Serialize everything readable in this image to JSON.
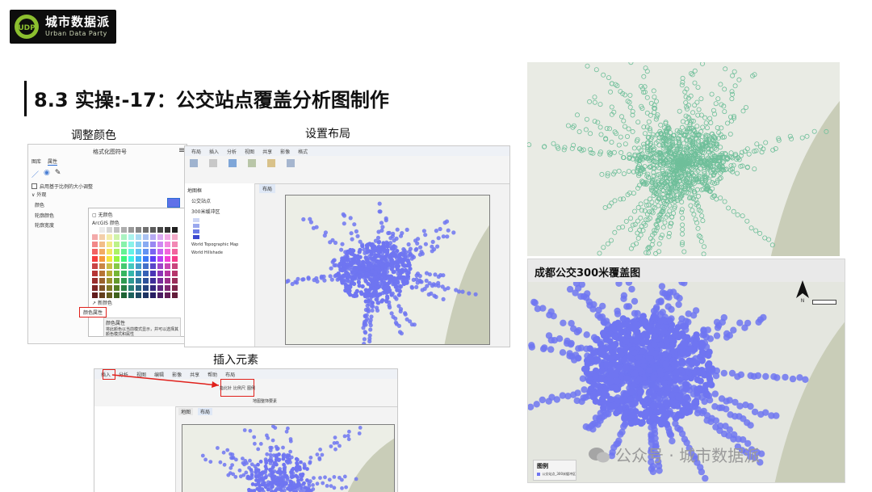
{
  "logo": {
    "name_cn": "城市数据派",
    "name_en": "Urban Data Party"
  },
  "title": "8.3 实操:-17：公交站点覆盖分析图制作",
  "captions": {
    "adjust_color": "调整颜色",
    "set_layout": "设置布局",
    "insert_elements": "插入元素"
  },
  "symbol_panel": {
    "header": "格式化图符号",
    "tabs": [
      "图库",
      "属性"
    ],
    "checkbox_label": "启用基于比例的大小调整",
    "section": "外观",
    "rows": [
      "颜色",
      "轮廓颜色",
      "轮廓宽度"
    ],
    "palette": {
      "no_color": "无颜色",
      "scheme": "ArcGIS 颜色",
      "new_color": "新颜色",
      "color_props": "颜色属性",
      "tooltip_title": "颜色属性",
      "tooltip_text": "将此颜色以当前模式显示，并可以选择其颜色模式和属性"
    }
  },
  "layout_panel": {
    "tabs": [
      "布局",
      "插入",
      "分析",
      "视图",
      "共享",
      "影像",
      "格式"
    ],
    "map_tab": "布局",
    "contents": [
      "地图框",
      "公交站点",
      "300米缓冲区",
      "World Topographic Map",
      "World Hillshade"
    ]
  },
  "insert_panel": {
    "tabs": [
      "插入",
      "分析",
      "视图",
      "编辑",
      "影像",
      "共享",
      "帮助",
      "布局"
    ],
    "highlight_buttons": [
      "指北针",
      "比例尺",
      "图例"
    ],
    "group_label": "地图整饰要素",
    "tab_labels": [
      "地图",
      "布局"
    ]
  },
  "map_top": {
    "kind": "stations"
  },
  "map_bottom": {
    "title": "成都公交300米覆盖图",
    "north_arrow_label": "N",
    "legend_title": "图例",
    "legend_item": "公交站点_300米缓冲区"
  },
  "watermark": "公众号 · 城市数据派",
  "colors": {
    "accent_blue": "#6f75f1",
    "station_green": "#6fbf9a",
    "highlight_red": "#e0201b"
  }
}
